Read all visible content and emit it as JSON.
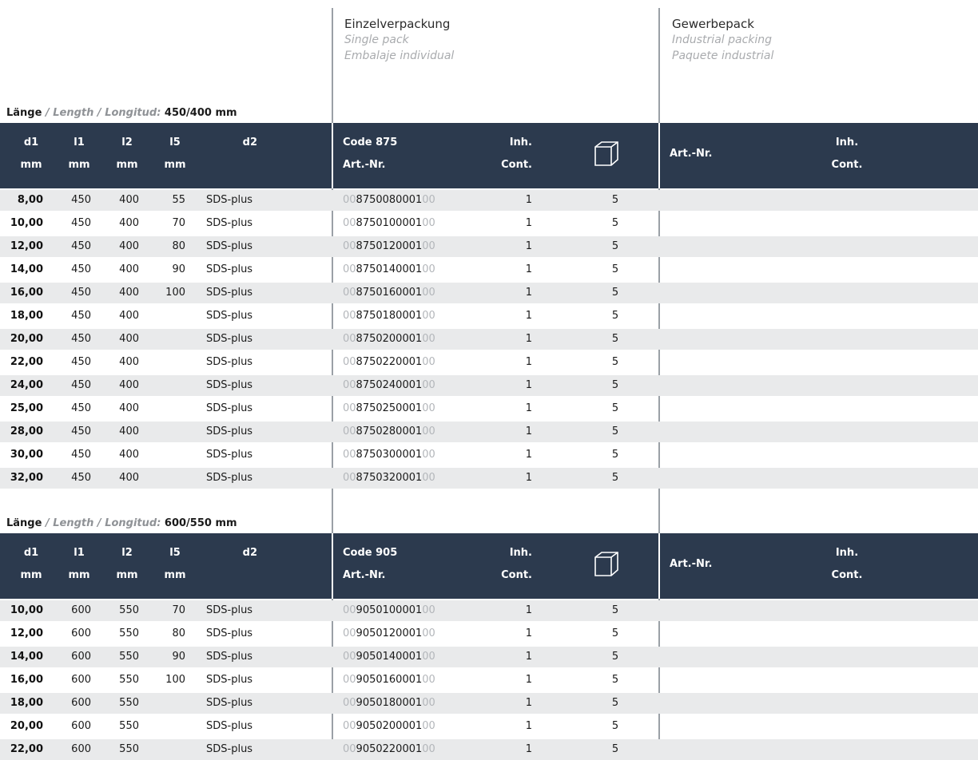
{
  "columns": {
    "single": {
      "de": "Einzelverpackung",
      "en": "Single pack",
      "es": "Embalaje individual"
    },
    "industrial": {
      "de": "Gewerbepack",
      "en": "Industrial packing",
      "es": "Paquete industrial"
    }
  },
  "headers": {
    "d1": "d1",
    "l1": "l1",
    "l2": "l2",
    "l5": "l5",
    "d2": "d2",
    "mm": "mm",
    "artnr": "Art.-Nr.",
    "inh": "Inh.",
    "cont": "Cont.",
    "pack_icon": "box-icon"
  },
  "sections": [
    {
      "label_de": "Länge",
      "label_sep": "/",
      "label_en": "Length",
      "label_es": "Longitud:",
      "length": "450/400 mm",
      "code": "Code 875",
      "rows": [
        {
          "d1": "8,00",
          "l1": "450",
          "l2": "400",
          "l5": "55",
          "d2": "SDS-plus",
          "pre": "00",
          "art": "8750080001",
          "suf": "00",
          "inh": "1",
          "pack": "5"
        },
        {
          "d1": "10,00",
          "l1": "450",
          "l2": "400",
          "l5": "70",
          "d2": "SDS-plus",
          "pre": "00",
          "art": "8750100001",
          "suf": "00",
          "inh": "1",
          "pack": "5"
        },
        {
          "d1": "12,00",
          "l1": "450",
          "l2": "400",
          "l5": "80",
          "d2": "SDS-plus",
          "pre": "00",
          "art": "8750120001",
          "suf": "00",
          "inh": "1",
          "pack": "5"
        },
        {
          "d1": "14,00",
          "l1": "450",
          "l2": "400",
          "l5": "90",
          "d2": "SDS-plus",
          "pre": "00",
          "art": "8750140001",
          "suf": "00",
          "inh": "1",
          "pack": "5"
        },
        {
          "d1": "16,00",
          "l1": "450",
          "l2": "400",
          "l5": "100",
          "d2": "SDS-plus",
          "pre": "00",
          "art": "8750160001",
          "suf": "00",
          "inh": "1",
          "pack": "5"
        },
        {
          "d1": "18,00",
          "l1": "450",
          "l2": "400",
          "l5": "",
          "d2": "SDS-plus",
          "pre": "00",
          "art": "8750180001",
          "suf": "00",
          "inh": "1",
          "pack": "5"
        },
        {
          "d1": "20,00",
          "l1": "450",
          "l2": "400",
          "l5": "",
          "d2": "SDS-plus",
          "pre": "00",
          "art": "8750200001",
          "suf": "00",
          "inh": "1",
          "pack": "5"
        },
        {
          "d1": "22,00",
          "l1": "450",
          "l2": "400",
          "l5": "",
          "d2": "SDS-plus",
          "pre": "00",
          "art": "8750220001",
          "suf": "00",
          "inh": "1",
          "pack": "5"
        },
        {
          "d1": "24,00",
          "l1": "450",
          "l2": "400",
          "l5": "",
          "d2": "SDS-plus",
          "pre": "00",
          "art": "8750240001",
          "suf": "00",
          "inh": "1",
          "pack": "5"
        },
        {
          "d1": "25,00",
          "l1": "450",
          "l2": "400",
          "l5": "",
          "d2": "SDS-plus",
          "pre": "00",
          "art": "8750250001",
          "suf": "00",
          "inh": "1",
          "pack": "5"
        },
        {
          "d1": "28,00",
          "l1": "450",
          "l2": "400",
          "l5": "",
          "d2": "SDS-plus",
          "pre": "00",
          "art": "8750280001",
          "suf": "00",
          "inh": "1",
          "pack": "5"
        },
        {
          "d1": "30,00",
          "l1": "450",
          "l2": "400",
          "l5": "",
          "d2": "SDS-plus",
          "pre": "00",
          "art": "8750300001",
          "suf": "00",
          "inh": "1",
          "pack": "5"
        },
        {
          "d1": "32,00",
          "l1": "450",
          "l2": "400",
          "l5": "",
          "d2": "SDS-plus",
          "pre": "00",
          "art": "8750320001",
          "suf": "00",
          "inh": "1",
          "pack": "5"
        }
      ]
    },
    {
      "label_de": "Länge",
      "label_sep": "/",
      "label_en": "Length",
      "label_es": "Longitud:",
      "length": "600/550 mm",
      "code": "Code 905",
      "rows": [
        {
          "d1": "10,00",
          "l1": "600",
          "l2": "550",
          "l5": "70",
          "d2": "SDS-plus",
          "pre": "00",
          "art": "9050100001",
          "suf": "00",
          "inh": "1",
          "pack": "5"
        },
        {
          "d1": "12,00",
          "l1": "600",
          "l2": "550",
          "l5": "80",
          "d2": "SDS-plus",
          "pre": "00",
          "art": "9050120001",
          "suf": "00",
          "inh": "1",
          "pack": "5"
        },
        {
          "d1": "14,00",
          "l1": "600",
          "l2": "550",
          "l5": "90",
          "d2": "SDS-plus",
          "pre": "00",
          "art": "9050140001",
          "suf": "00",
          "inh": "1",
          "pack": "5"
        },
        {
          "d1": "16,00",
          "l1": "600",
          "l2": "550",
          "l5": "100",
          "d2": "SDS-plus",
          "pre": "00",
          "art": "9050160001",
          "suf": "00",
          "inh": "1",
          "pack": "5"
        },
        {
          "d1": "18,00",
          "l1": "600",
          "l2": "550",
          "l5": "",
          "d2": "SDS-plus",
          "pre": "00",
          "art": "9050180001",
          "suf": "00",
          "inh": "1",
          "pack": "5"
        },
        {
          "d1": "20,00",
          "l1": "600",
          "l2": "550",
          "l5": "",
          "d2": "SDS-plus",
          "pre": "00",
          "art": "9050200001",
          "suf": "00",
          "inh": "1",
          "pack": "5"
        },
        {
          "d1": "22,00",
          "l1": "600",
          "l2": "550",
          "l5": "",
          "d2": "SDS-plus",
          "pre": "00",
          "art": "9050220001",
          "suf": "00",
          "inh": "1",
          "pack": "5"
        }
      ]
    }
  ]
}
